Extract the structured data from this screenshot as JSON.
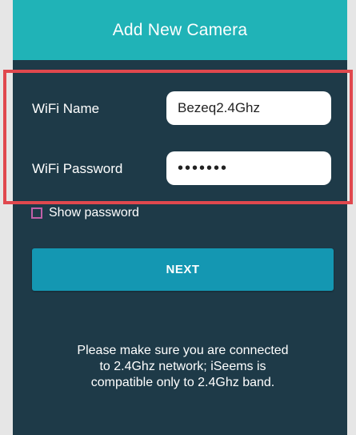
{
  "header": {
    "title": "Add New Camera"
  },
  "form": {
    "wifi_name_label": "WiFi Name",
    "wifi_name_value": "Bezeq2.4Ghz",
    "wifi_password_label": "WiFi Password",
    "wifi_password_value": "•••••••",
    "show_password_label": "Show password",
    "show_password_checked": false
  },
  "actions": {
    "next_label": "NEXT"
  },
  "notice": {
    "lines": [
      "Please make sure you are connected",
      "to 2.4Ghz network; iSeems is",
      "compatible only to 2.4Ghz band."
    ]
  },
  "colors": {
    "header": "#20b3b7",
    "background": "#1e3a48",
    "button": "#1497b2",
    "highlight": "#e0484e",
    "checkbox_border": "#c060a8"
  }
}
